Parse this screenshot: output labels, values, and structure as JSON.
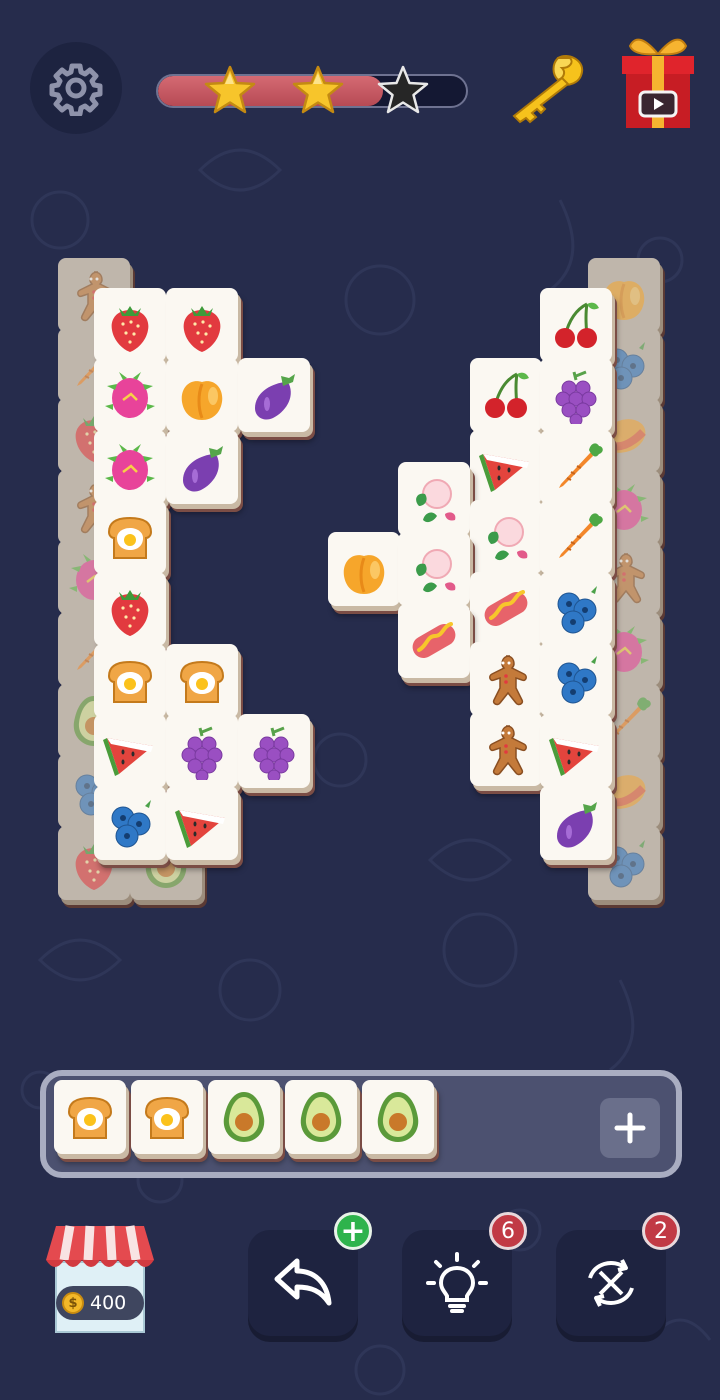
{
  "header": {
    "settings_icon": "gear-icon",
    "progress": {
      "fraction": 0.73,
      "stars_earned": 2,
      "stars_total": 3
    },
    "key_icon": "key-icon",
    "gift_icon": "gift-video-icon"
  },
  "board": {
    "tiles": [
      {
        "id": "l-d1",
        "fruit": "gingerbread",
        "dim": true
      },
      {
        "id": "l-d2",
        "fruit": "carrot",
        "dim": true
      },
      {
        "id": "l-d3",
        "fruit": "strawberry",
        "dim": true
      },
      {
        "id": "l-d4",
        "fruit": "gingerbread",
        "dim": true
      },
      {
        "id": "l-d5",
        "fruit": "dragonfruit",
        "dim": true
      },
      {
        "id": "l-d6",
        "fruit": "carrot",
        "dim": true
      },
      {
        "id": "l-d7",
        "fruit": "avocado",
        "dim": true
      },
      {
        "id": "l-d8",
        "fruit": "blueberry",
        "dim": true
      },
      {
        "id": "l-d9",
        "fruit": "strawberry",
        "dim": true
      },
      {
        "id": "l-d10",
        "fruit": "avocado",
        "dim": true
      },
      {
        "id": "l1",
        "fruit": "strawberry"
      },
      {
        "id": "l2",
        "fruit": "strawberry"
      },
      {
        "id": "l3",
        "fruit": "dragonfruit"
      },
      {
        "id": "l4",
        "fruit": "peach"
      },
      {
        "id": "l5",
        "fruit": "eggplant"
      },
      {
        "id": "l6",
        "fruit": "dragonfruit"
      },
      {
        "id": "l7",
        "fruit": "eggplant"
      },
      {
        "id": "l8",
        "fruit": "egg-toast"
      },
      {
        "id": "l9",
        "fruit": "strawberry"
      },
      {
        "id": "l10",
        "fruit": "egg-toast"
      },
      {
        "id": "l11",
        "fruit": "egg-toast"
      },
      {
        "id": "l12",
        "fruit": "watermelon"
      },
      {
        "id": "l13",
        "fruit": "grapes"
      },
      {
        "id": "l14",
        "fruit": "grapes"
      },
      {
        "id": "l15",
        "fruit": "blueberry"
      },
      {
        "id": "l16",
        "fruit": "watermelon"
      },
      {
        "id": "r-d1",
        "fruit": "peach",
        "dim": true
      },
      {
        "id": "r-d2",
        "fruit": "blueberry",
        "dim": true
      },
      {
        "id": "r-d3",
        "fruit": "mango",
        "dim": true
      },
      {
        "id": "r-d4",
        "fruit": "dragonfruit",
        "dim": true
      },
      {
        "id": "r-d5",
        "fruit": "gingerbread",
        "dim": true
      },
      {
        "id": "r-d6",
        "fruit": "dragonfruit",
        "dim": true
      },
      {
        "id": "r-d7",
        "fruit": "carrot",
        "dim": true
      },
      {
        "id": "r-d8",
        "fruit": "mango",
        "dim": true
      },
      {
        "id": "r-d9",
        "fruit": "blueberry",
        "dim": true
      },
      {
        "id": "r1",
        "fruit": "cherry"
      },
      {
        "id": "r2",
        "fruit": "cherry"
      },
      {
        "id": "r3",
        "fruit": "grapes"
      },
      {
        "id": "r4",
        "fruit": "watermelon"
      },
      {
        "id": "r5",
        "fruit": "carrot"
      },
      {
        "id": "r6",
        "fruit": "lychee"
      },
      {
        "id": "r7",
        "fruit": "lychee"
      },
      {
        "id": "r8",
        "fruit": "carrot"
      },
      {
        "id": "r9",
        "fruit": "peach"
      },
      {
        "id": "r10",
        "fruit": "lychee"
      },
      {
        "id": "r11",
        "fruit": "hotdog"
      },
      {
        "id": "r12",
        "fruit": "blueberry"
      },
      {
        "id": "r13",
        "fruit": "hotdog"
      },
      {
        "id": "r14",
        "fruit": "gingerbread"
      },
      {
        "id": "r15",
        "fruit": "blueberry"
      },
      {
        "id": "r16",
        "fruit": "gingerbread"
      },
      {
        "id": "r17",
        "fruit": "watermelon"
      },
      {
        "id": "r18",
        "fruit": "eggplant"
      }
    ]
  },
  "tray": {
    "slots": [
      "egg-toast",
      "egg-toast",
      "avocado",
      "avocado",
      "avocado"
    ],
    "add_icon": "plus-icon"
  },
  "footer": {
    "coins": "400",
    "coin_symbol": "$",
    "undo": {
      "icon": "undo-icon",
      "badge": "+"
    },
    "hint": {
      "icon": "lightbulb-icon",
      "badge": "6"
    },
    "shuffle": {
      "icon": "shuffle-icon",
      "badge": "2"
    }
  },
  "colors": {
    "background": "#262c4c",
    "progress_fill": "#c9535d",
    "badge": "#c13a45",
    "badge_green": "#2eb34c"
  }
}
